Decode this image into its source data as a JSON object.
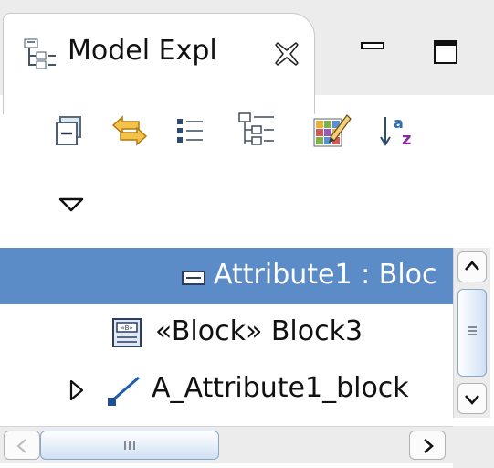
{
  "view": {
    "title": "Model Expl",
    "icon": "model-explorer-icon",
    "close_icon": "close-icon",
    "minimize_icon": "minimize-icon",
    "maximize_icon": "maximize-icon"
  },
  "toolbar": {
    "buttons": [
      {
        "name": "collapse-all-icon"
      },
      {
        "name": "link-with-editor-icon"
      },
      {
        "name": "flat-list-icon"
      },
      {
        "name": "hierarchical-tree-icon"
      },
      {
        "name": "customize-view-icon"
      },
      {
        "name": "sort-alphabetically-icon"
      }
    ],
    "view_menu_icon": "view-menu-icon"
  },
  "tree": {
    "items": [
      {
        "label": "Attribute1 : Bloc",
        "icon": "attribute-icon",
        "selected": true,
        "expandable": false
      },
      {
        "label": "«Block» Block3",
        "icon": "block-icon",
        "selected": false,
        "expandable": false
      },
      {
        "label": "A_Attribute1_block",
        "icon": "association-icon",
        "selected": false,
        "expandable": true
      }
    ]
  },
  "colors": {
    "selection": "#5b8cc8",
    "tab_background": "#ececec",
    "scrollbar_thumb": "#cfe0f4"
  }
}
